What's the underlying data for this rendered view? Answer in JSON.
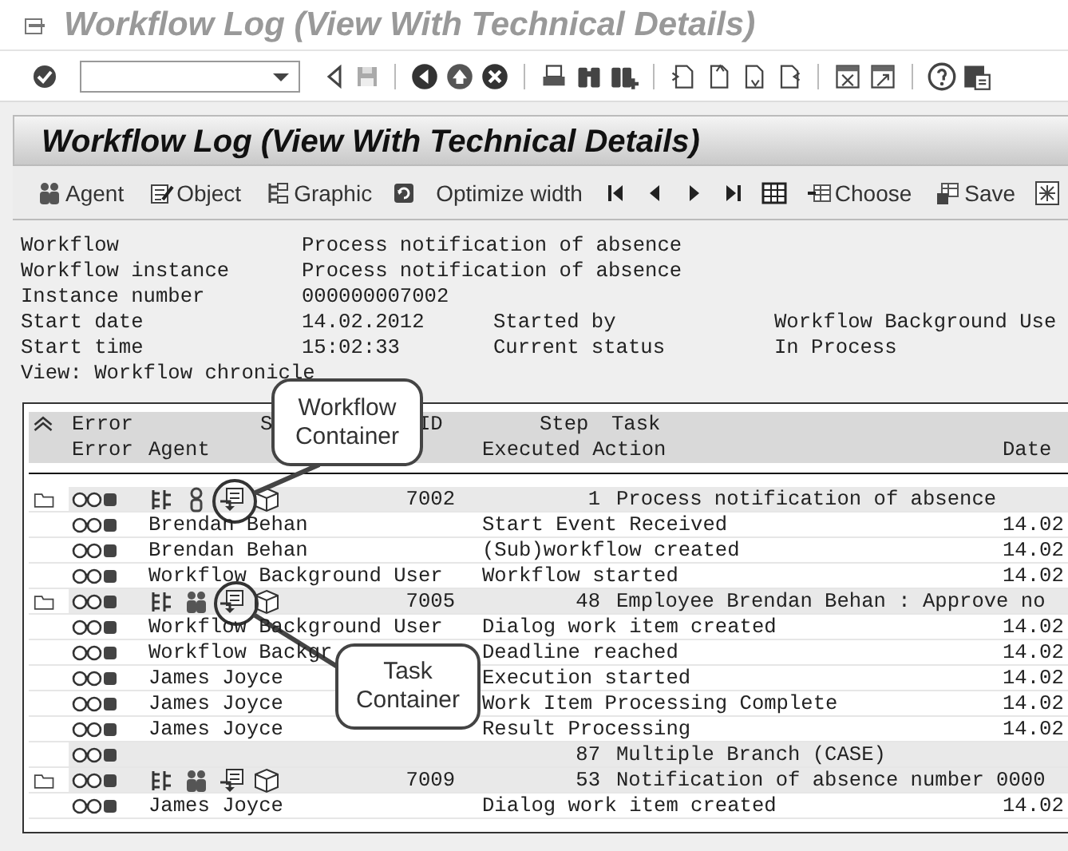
{
  "window": {
    "title": "Workflow Log (View With Technical Details)"
  },
  "app": {
    "title": "Workflow Log (View With Technical Details)"
  },
  "app_toolbar": [
    {
      "label": "Agent"
    },
    {
      "label": "Object"
    },
    {
      "label": "Graphic"
    },
    {
      "label": "Optimize width"
    },
    {
      "label": "Choose"
    },
    {
      "label": "Save"
    }
  ],
  "info": [
    {
      "label": "Workflow",
      "value": "Process notification of absence"
    },
    {
      "label": "Workflow instance",
      "value": "Process notification of absence"
    },
    {
      "label": "Instance number",
      "value": "000000007002"
    },
    {
      "label": "Start date",
      "value": "14.02.2012",
      "label_2": "Started by",
      "value_2": "Workflow Background Use"
    },
    {
      "label": "Start time",
      "value": "15:02:33",
      "label_2": "Current status",
      "value_2": "In Process"
    },
    {
      "label": "View: Workflow chronicle"
    }
  ],
  "table": {
    "columns_line_1": [
      "Error",
      "S",
      "ID",
      "Step",
      "Task"
    ],
    "columns_line_2": [
      "Error",
      "Agent",
      "Executed Action",
      "Date"
    ],
    "rows": [
      {
        "kind": "step",
        "group_agent": false,
        "id": "7002",
        "step": "1",
        "task": "Process notification of absence"
      },
      {
        "kind": "action",
        "agent": "Brendan Behan",
        "action": "Start Event Received",
        "date": "14.02"
      },
      {
        "kind": "action",
        "agent": "Brendan Behan",
        "action": "(Sub)workflow created",
        "date": "14.02"
      },
      {
        "kind": "action",
        "agent": "Workflow Background User",
        "action": "Workflow started",
        "date": "14.02"
      },
      {
        "kind": "step",
        "group_agent": true,
        "id": "7005",
        "step": "48",
        "task": "Employee Brendan Behan : Approve no"
      },
      {
        "kind": "action",
        "agent": "Workflow Background User",
        "action": "Dialog work item created",
        "date": "14.02"
      },
      {
        "kind": "action",
        "agent": "Workflow Backgr",
        "action": "Deadline reached",
        "date": "14.02"
      },
      {
        "kind": "action",
        "agent": "James Joyce",
        "action": "Execution started",
        "date": "14.02"
      },
      {
        "kind": "action",
        "agent": "James Joyce",
        "action": "Work Item Processing Complete",
        "date": "14.02"
      },
      {
        "kind": "action",
        "agent": "James Joyce",
        "action": "Result Processing",
        "date": "14.02"
      },
      {
        "kind": "branch",
        "step": "87",
        "task": "Multiple Branch (CASE)"
      },
      {
        "kind": "step",
        "group_agent": true,
        "id": "7009",
        "step": "53",
        "task": "Notification of absence number 0000"
      },
      {
        "kind": "action",
        "agent": "James Joyce",
        "action": "Dialog work item created",
        "date": "14.02"
      }
    ]
  },
  "callouts": [
    {
      "text": "Workflow Container"
    },
    {
      "text": "Task Container"
    }
  ]
}
